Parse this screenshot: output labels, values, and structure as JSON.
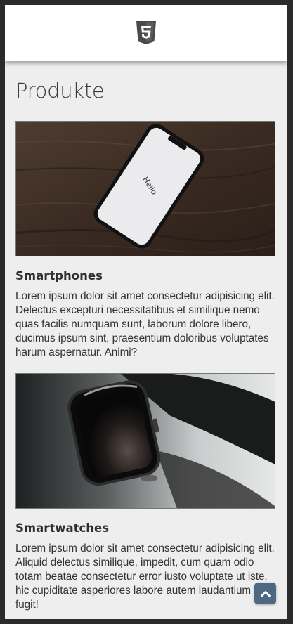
{
  "header": {
    "logo_icon": "html5-logo-icon"
  },
  "main": {
    "page_title": "Produkte",
    "cards": [
      {
        "image_icon": "smartphone-hello-photo",
        "image_text": "Hello",
        "title": "Smartphones",
        "text": "Lorem ipsum dolor sit amet consectetur adipisicing elit. Delectus excepturi necessitatibus et similique nemo quas facilis numquam sunt, laborum dolore libero, ducimus ipsum sint, praesentium doloribus voluptates harum aspernatur. Animi?"
      },
      {
        "image_icon": "smartwatch-photo",
        "title": "Smartwatches",
        "text": "Lorem ipsum dolor sit amet consectetur adipisicing elit. Aliquid delectus similique, impedit, cum quam odio totam beatae consectetur error iusto voluptate ut iste, hic cupiditate asperiores labore autem laudantium fugit!"
      }
    ]
  },
  "scroll_top_button": {
    "icon": "chevron-up-icon"
  },
  "colors": {
    "header_bg": "#ffffff",
    "page_bg": "#efeeef",
    "button_bg": "#4d6883",
    "outer_bg": "#2b2b2b"
  }
}
